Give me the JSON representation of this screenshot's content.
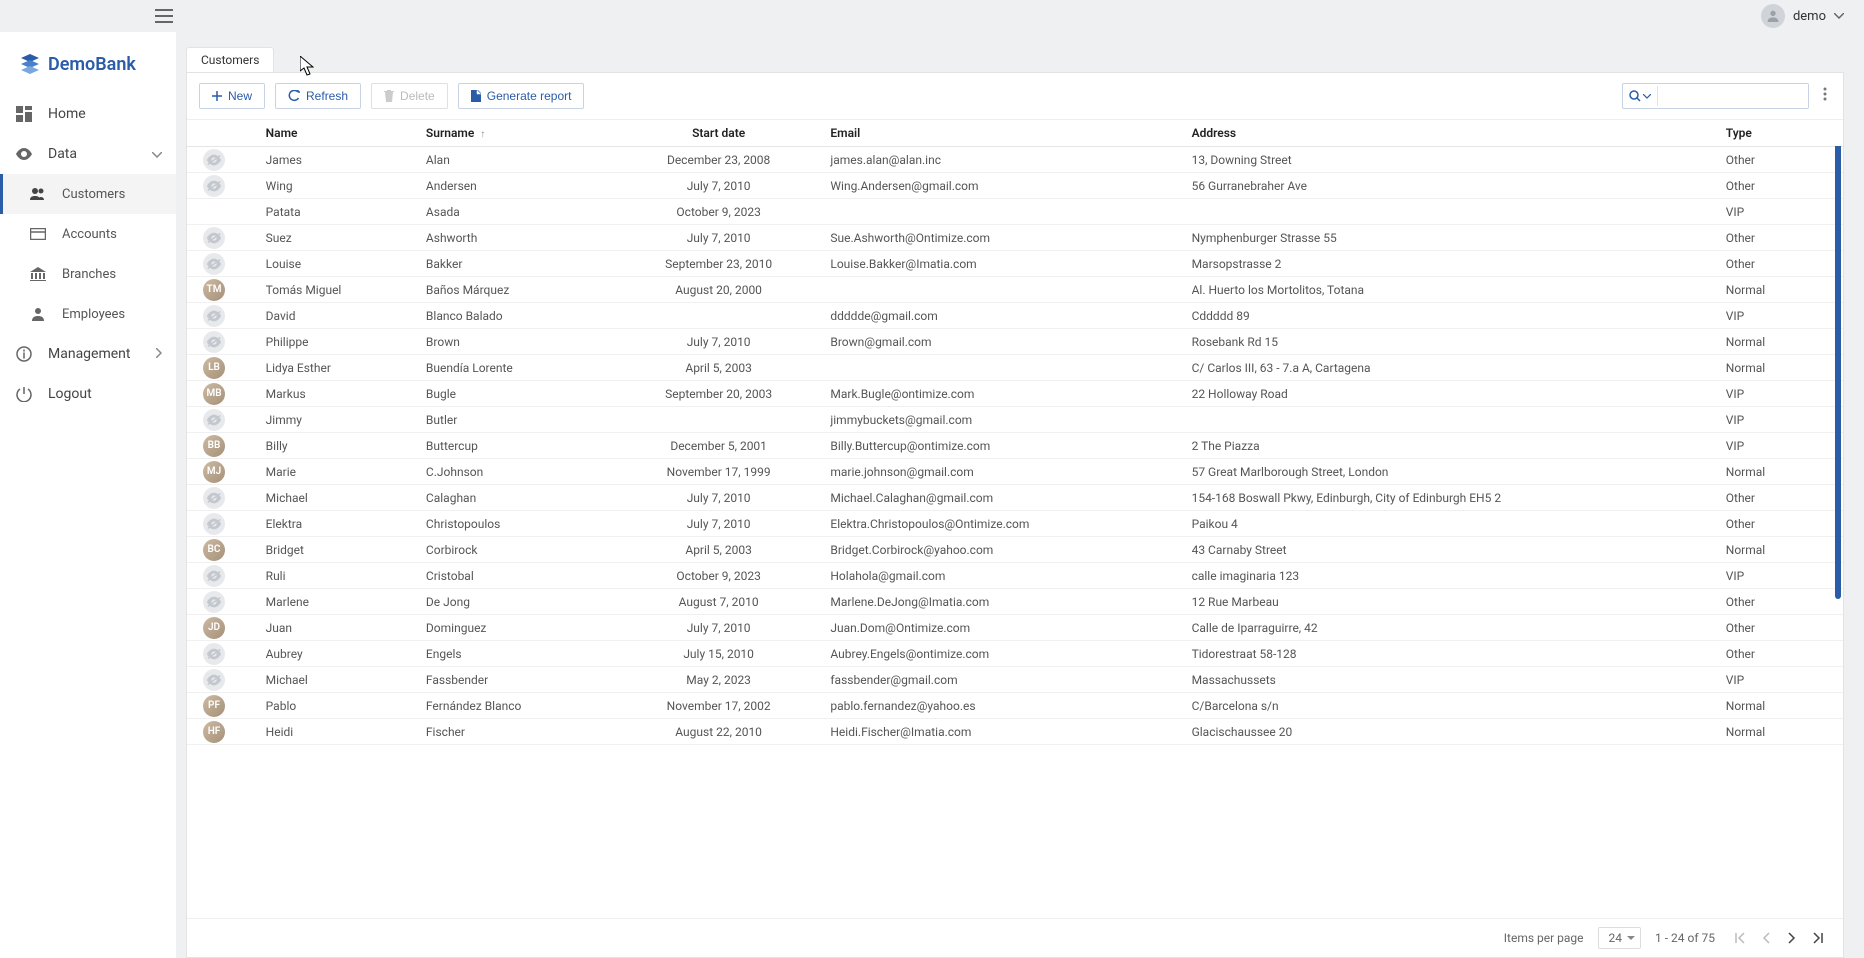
{
  "header": {
    "user_name": "demo"
  },
  "brand": {
    "name": "DemoBank"
  },
  "sidebar": {
    "home": "Home",
    "data": "Data",
    "customers": "Customers",
    "accounts": "Accounts",
    "branches": "Branches",
    "employees": "Employees",
    "management": "Management",
    "logout": "Logout"
  },
  "tabs": {
    "customers": "Customers"
  },
  "toolbar": {
    "new_label": "New",
    "refresh_label": "Refresh",
    "delete_label": "Delete",
    "report_label": "Generate report",
    "search_placeholder": ""
  },
  "columns": {
    "name": "Name",
    "surname": "Surname",
    "start_date": "Start date",
    "email": "Email",
    "address": "Address",
    "type": "Type"
  },
  "rows": [
    {
      "avatar": "ph",
      "name": "James",
      "surname": "Alan",
      "start": "December 23, 2008",
      "email": "james.alan@alan.inc",
      "address": "13, Downing Street",
      "type": "Other"
    },
    {
      "avatar": "ph",
      "name": "Wing",
      "surname": "Andersen",
      "start": "July 7, 2010",
      "email": "Wing.Andersen@gmail.com",
      "address": "56 Gurranebraher Ave",
      "type": "Other"
    },
    {
      "avatar": "none",
      "name": "Patata",
      "surname": "Asada",
      "start": "October 9, 2023",
      "email": "",
      "address": "",
      "type": "VIP"
    },
    {
      "avatar": "ph",
      "name": "Suez",
      "surname": "Ashworth",
      "start": "July 7, 2010",
      "email": "Sue.Ashworth@Ontimize.com",
      "address": "Nymphenburger Strasse 55",
      "type": "Other"
    },
    {
      "avatar": "ph",
      "name": "Louise",
      "surname": "Bakker",
      "start": "September 23, 2010",
      "email": "Louise.Bakker@Imatia.com",
      "address": "Marsopstrasse 2",
      "type": "Other"
    },
    {
      "avatar": "img",
      "initials": "TM",
      "name": "Tomás Miguel",
      "surname": "Baños Márquez",
      "start": "August 20, 2000",
      "email": "",
      "address": "Al. Huerto los Mortolitos, Totana",
      "type": "Normal"
    },
    {
      "avatar": "ph",
      "name": "David",
      "surname": "Blanco Balado",
      "start": "",
      "email": "ddddde@gmail.com",
      "address": "Cddddd 89",
      "type": "VIP"
    },
    {
      "avatar": "ph",
      "name": "Philippe",
      "surname": "Brown",
      "start": "July 7, 2010",
      "email": "Brown@gmail.com",
      "address": "Rosebank Rd 15",
      "type": "Normal"
    },
    {
      "avatar": "img",
      "initials": "LB",
      "name": "Lidya Esther",
      "surname": "Buendía Lorente",
      "start": "April 5, 2003",
      "email": "",
      "address": "C/ Carlos III, 63 - 7.a A, Cartagena",
      "type": "Normal"
    },
    {
      "avatar": "img",
      "initials": "MB",
      "name": "Markus",
      "surname": "Bugle",
      "start": "September 20, 2003",
      "email": "Mark.Bugle@ontimize.com",
      "address": "22 Holloway Road",
      "type": "VIP"
    },
    {
      "avatar": "ph",
      "name": "Jimmy",
      "surname": "Butler",
      "start": "",
      "email": "jimmybuckets@gmail.com",
      "address": "",
      "type": "VIP"
    },
    {
      "avatar": "img",
      "initials": "BB",
      "name": "Billy",
      "surname": "Buttercup",
      "start": "December 5, 2001",
      "email": "Billy.Buttercup@ontimize.com",
      "address": "2 The Piazza",
      "type": "VIP"
    },
    {
      "avatar": "img",
      "initials": "MJ",
      "name": "Marie",
      "surname": "C.Johnson",
      "start": "November 17, 1999",
      "email": "marie.johnson@gmail.com",
      "address": "57 Great Marlborough Street, London",
      "type": "Normal"
    },
    {
      "avatar": "ph",
      "name": "Michael",
      "surname": "Calaghan",
      "start": "July 7, 2010",
      "email": "Michael.Calaghan@gmail.com",
      "address": "154-168 Boswall Pkwy, Edinburgh, City of Edinburgh EH5 2",
      "type": "Other"
    },
    {
      "avatar": "ph",
      "name": "Elektra",
      "surname": "Christopoulos",
      "start": "July 7, 2010",
      "email": "Elektra.Christopoulos@Ontimize.com",
      "address": "Paikou 4",
      "type": "Other"
    },
    {
      "avatar": "img",
      "initials": "BC",
      "name": "Bridget",
      "surname": "Corbirock",
      "start": "April 5, 2003",
      "email": "Bridget.Corbirock@yahoo.com",
      "address": "43 Carnaby Street",
      "type": "Normal"
    },
    {
      "avatar": "ph",
      "name": "Ruli",
      "surname": "Cristobal",
      "start": "October 9, 2023",
      "email": "Holahola@gmail.com",
      "address": "calle imaginaria 123",
      "type": "VIP"
    },
    {
      "avatar": "ph",
      "name": "Marlene",
      "surname": "De Jong",
      "start": "August 7, 2010",
      "email": "Marlene.DeJong@Imatia.com",
      "address": "12 Rue Marbeau",
      "type": "Other"
    },
    {
      "avatar": "img",
      "initials": "JD",
      "name": "Juan",
      "surname": "Dominguez",
      "start": "July 7, 2010",
      "email": "Juan.Dom@Ontimize.com",
      "address": "Calle de Iparraguirre, 42",
      "type": "Other"
    },
    {
      "avatar": "ph",
      "name": "Aubrey",
      "surname": "Engels",
      "start": "July 15, 2010",
      "email": "Aubrey.Engels@ontimize.com",
      "address": "Tidorestraat 58-128",
      "type": "Other"
    },
    {
      "avatar": "ph",
      "name": "Michael",
      "surname": "Fassbender",
      "start": "May 2, 2023",
      "email": "fassbender@gmail.com",
      "address": "Massachussets",
      "type": "VIP"
    },
    {
      "avatar": "img",
      "initials": "PF",
      "name": "Pablo",
      "surname": "Fernández Blanco",
      "start": "November 17, 2002",
      "email": "pablo.fernandez@yahoo.es",
      "address": "C/Barcelona s/n",
      "type": "Normal"
    },
    {
      "avatar": "img",
      "initials": "HF",
      "name": "Heidi",
      "surname": "Fischer",
      "start": "August 22, 2010",
      "email": "Heidi.Fischer@Imatia.com",
      "address": "Glacischaussee 20",
      "type": "Normal"
    }
  ],
  "pager": {
    "items_per_page_label": "Items per page",
    "items_per_page_value": "24",
    "range": "1 - 24 of 75"
  }
}
